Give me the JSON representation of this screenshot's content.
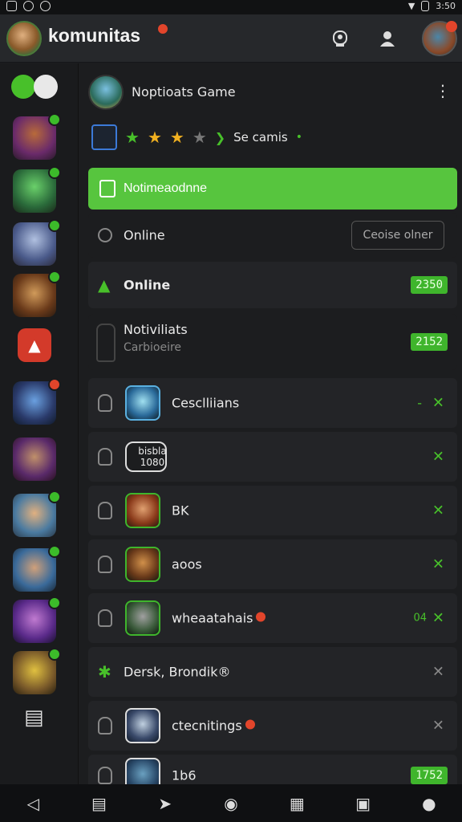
{
  "statusbar": {
    "time": "3:50"
  },
  "appbar": {
    "title": "komunitas"
  },
  "game": {
    "name": "Noptioats Game",
    "rating_text": "Se camis"
  },
  "hero_button": {
    "label": "Notimeaodnne"
  },
  "online_row": {
    "label": "Online",
    "button": "Ceoise olner"
  },
  "online_section": {
    "label": "Online",
    "count": "2350"
  },
  "notification_row": {
    "title": "Notiviliats",
    "subtitle": "Carbioeire",
    "count": "2152"
  },
  "members": [
    {
      "name": "Cesclliians"
    },
    {
      "name": "bisbla 1080"
    },
    {
      "name": "BK"
    },
    {
      "name": "aoos"
    },
    {
      "name": "wheaatahais",
      "side": "04"
    },
    {
      "name": "Dersk, Brondik®",
      "bold_prefix": "Dersk,"
    },
    {
      "name": "ctecnitings"
    },
    {
      "name": "1b6",
      "count": "1752"
    }
  ],
  "colors": {
    "accent": "#57c53e",
    "badge_red": "#e2452b"
  }
}
